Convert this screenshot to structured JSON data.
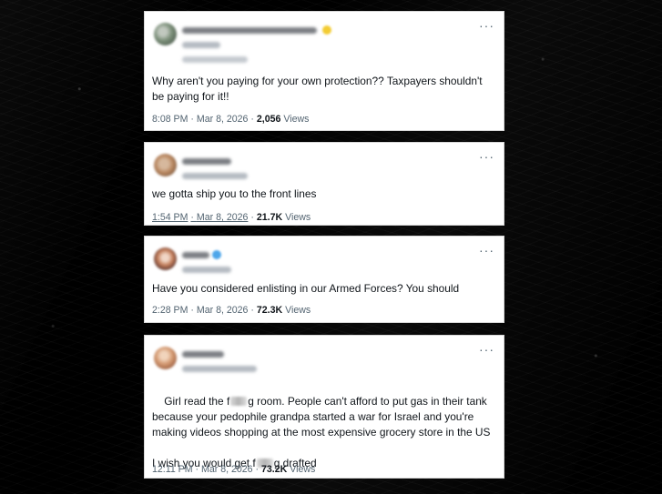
{
  "tweets": [
    {
      "text": "Why aren't you paying for your own protection?? Taxpayers shouldn't be paying for it!!",
      "time": "8:08 PM",
      "date": "Mar 8, 2026",
      "views_count": "2,056",
      "views_label": "Views",
      "more": "···"
    },
    {
      "text": "we gotta ship you to the front lines",
      "time": "1:54 PM",
      "date": "Mar 8, 2026",
      "views_count": "21.7K",
      "views_label": "Views",
      "more": "···"
    },
    {
      "text": "Have you considered enlisting in our Armed Forces? You should",
      "time": "2:28 PM",
      "date": "Mar 8, 2026",
      "views_count": "72.3K",
      "views_label": "Views",
      "more": "···"
    },
    {
      "text_part1": "Girl read the f",
      "text_part2": "g room. People can't afford to put gas in their tank because your pedophile grandpa started a war for Israel and you're making videos shopping at the most expensive grocery store in the US",
      "text_part3": "I wish you would get f",
      "text_part4": "g drafted",
      "time": "12:11 PM",
      "date": "Mar 8, 2026",
      "views_count": "73.2K",
      "views_label": "Views",
      "more": "···"
    }
  ],
  "colors": {
    "background": "#0b0b0b",
    "card": "#ffffff",
    "text": "#0f1419",
    "muted": "#536471",
    "verified_gold": "#f3cc33",
    "verified_blue": "#4ea6ea"
  }
}
